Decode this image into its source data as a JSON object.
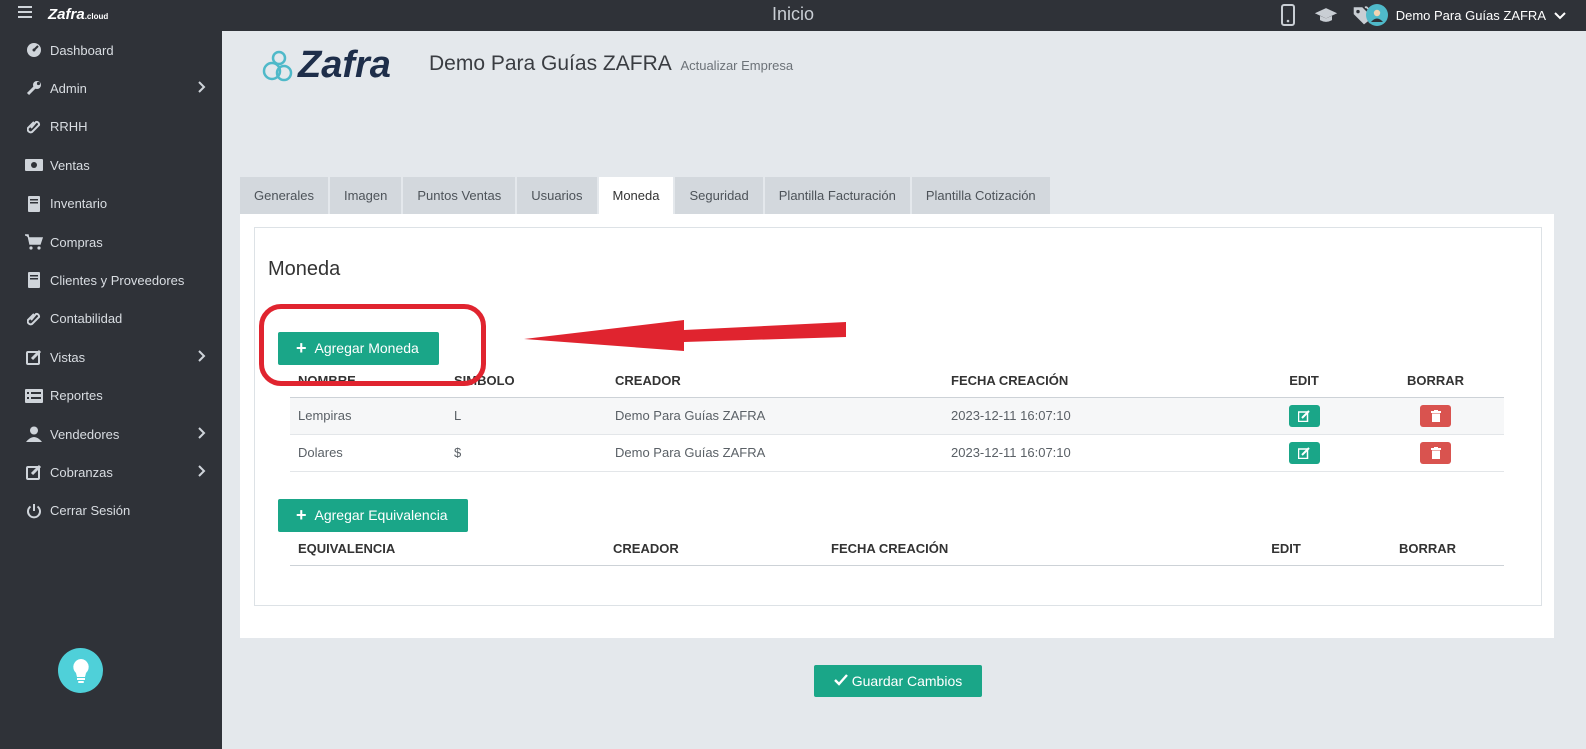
{
  "topbar": {
    "logo": "Zafra",
    "logo_suffix": ".cloud",
    "title": "Inicio",
    "user_name": "Demo Para Guías ZAFRA",
    "icons": [
      "mobile-icon",
      "graduation-cap-icon",
      "tags-icon"
    ]
  },
  "sidebar": {
    "items": [
      {
        "label": "Dashboard",
        "icon": "dashboard-icon",
        "has_submenu": false
      },
      {
        "label": "Admin",
        "icon": "wrench-icon",
        "has_submenu": true
      },
      {
        "label": "RRHH",
        "icon": "paperclip-icon",
        "has_submenu": false
      },
      {
        "label": "Ventas",
        "icon": "money-icon",
        "has_submenu": false
      },
      {
        "label": "Inventario",
        "icon": "book-icon",
        "has_submenu": false
      },
      {
        "label": "Compras",
        "icon": "cart-icon",
        "has_submenu": false
      },
      {
        "label": "Clientes y Proveedores",
        "icon": "book-icon",
        "has_submenu": false
      },
      {
        "label": "Contabilidad",
        "icon": "paperclip-icon",
        "has_submenu": false
      },
      {
        "label": "Vistas",
        "icon": "edit-icon",
        "has_submenu": true
      },
      {
        "label": "Reportes",
        "icon": "list-icon",
        "has_submenu": false
      },
      {
        "label": "Vendedores",
        "icon": "user-icon",
        "has_submenu": true
      },
      {
        "label": "Cobranzas",
        "icon": "edit-icon",
        "has_submenu": true
      },
      {
        "label": "Cerrar Sesión",
        "icon": "power-icon",
        "has_submenu": false
      }
    ]
  },
  "header": {
    "brand": "Zafra",
    "company_name": "Demo Para Guías ZAFRA",
    "company_action": "Actualizar Empresa"
  },
  "tabs": [
    {
      "label": "Generales",
      "active": false
    },
    {
      "label": "Imagen",
      "active": false
    },
    {
      "label": "Puntos Ventas",
      "active": false
    },
    {
      "label": "Usuarios",
      "active": false
    },
    {
      "label": "Moneda",
      "active": true
    },
    {
      "label": "Seguridad",
      "active": false
    },
    {
      "label": "Plantilla Facturación",
      "active": false
    },
    {
      "label": "Plantilla Cotización",
      "active": false
    }
  ],
  "moneda": {
    "title": "Moneda",
    "add_currency_label": "Agregar Moneda",
    "currency_table": {
      "headers": [
        "NOMBRE",
        "SIMBOLO",
        "CREADOR",
        "FECHA CREACIÓN",
        "EDIT",
        "BORRAR"
      ],
      "rows": [
        {
          "nombre": "Lempiras",
          "simbolo": "L",
          "creador": "Demo Para Guías ZAFRA",
          "fecha": "2023-12-11 16:07:10"
        },
        {
          "nombre": "Dolares",
          "simbolo": "$",
          "creador": "Demo Para Guías ZAFRA",
          "fecha": "2023-12-11 16:07:10"
        }
      ]
    },
    "add_equivalence_label": "Agregar Equivalencia",
    "equivalence_table": {
      "headers": [
        "EQUIVALENCIA",
        "CREADOR",
        "FECHA CREACIÓN",
        "EDIT",
        "BORRAR"
      ],
      "rows": []
    }
  },
  "save_label": "Guardar Cambios",
  "colors": {
    "sidebar_bg": "#2f3238",
    "accent_green": "#1aa688",
    "delete_red": "#d9534f",
    "annotation_red": "#e0242f",
    "page_bg": "#e4e8ec"
  }
}
